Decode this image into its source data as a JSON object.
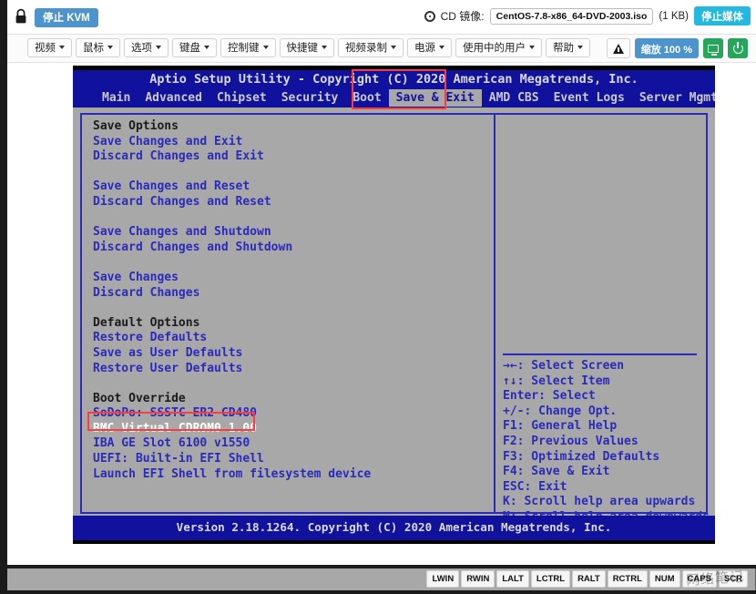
{
  "toolbar": {
    "lock_icon": "lock-icon",
    "stop_kvm_label": "停止 KVM",
    "cd_icon": "cd-disc-icon",
    "cd_label": "CD 镜像:",
    "cd_path": "CentOS-7.8-x86_64-DVD-2003.iso",
    "cd_size": "(1 KB)",
    "stop_media_label": "停止媒体"
  },
  "menubar": {
    "items": [
      {
        "label": "视频"
      },
      {
        "label": "鼠标"
      },
      {
        "label": "选项"
      },
      {
        "label": "键盘"
      },
      {
        "label": "控制键"
      },
      {
        "label": "快捷键"
      },
      {
        "label": "视频录制"
      },
      {
        "label": "电源"
      },
      {
        "label": "使用中的用户"
      },
      {
        "label": "帮助"
      }
    ],
    "warning_icon": "warning-triangle-icon",
    "zoom_label": "缩放 100 %",
    "monitor_icon": "monitor-icon",
    "power_icon": "power-icon"
  },
  "bios": {
    "title": "Aptio Setup Utility - Copyright (C) 2020 American Megatrends, Inc.",
    "tabs": [
      {
        "label": "Main",
        "active": false
      },
      {
        "label": "Advanced",
        "active": false
      },
      {
        "label": "Chipset",
        "active": false
      },
      {
        "label": "Security",
        "active": false
      },
      {
        "label": "Boot",
        "active": false
      },
      {
        "label": "Save & Exit",
        "active": true
      },
      {
        "label": "AMD CBS",
        "active": false
      },
      {
        "label": "Event Logs",
        "active": false
      },
      {
        "label": "Server Mgmt",
        "active": false
      }
    ],
    "left_pane": [
      {
        "text": "Save Options",
        "kind": "hdr"
      },
      {
        "text": "Save Changes and Exit",
        "kind": "opt"
      },
      {
        "text": "Discard Changes and Exit",
        "kind": "opt"
      },
      {
        "text": "",
        "kind": "gap"
      },
      {
        "text": "Save Changes and Reset",
        "kind": "opt"
      },
      {
        "text": "Discard Changes and Reset",
        "kind": "opt"
      },
      {
        "text": "",
        "kind": "gap"
      },
      {
        "text": "Save Changes and Shutdown",
        "kind": "opt"
      },
      {
        "text": "Discard Changes and Shutdown",
        "kind": "opt"
      },
      {
        "text": "",
        "kind": "gap"
      },
      {
        "text": "Save Changes",
        "kind": "opt"
      },
      {
        "text": "Discard Changes",
        "kind": "opt"
      },
      {
        "text": "",
        "kind": "gap"
      },
      {
        "text": "Default Options",
        "kind": "hdr"
      },
      {
        "text": "Restore Defaults",
        "kind": "opt"
      },
      {
        "text": "Save as User Defaults",
        "kind": "opt"
      },
      {
        "text": "Restore User Defaults",
        "kind": "opt"
      },
      {
        "text": "",
        "kind": "gap"
      },
      {
        "text": "Boot Override",
        "kind": "hdr"
      },
      {
        "text": "SoDoPo: SSSTC ER2 CD480",
        "kind": "opt"
      },
      {
        "text": "BMC Virtual CDROM0 1.00",
        "kind": "sel"
      },
      {
        "text": "IBA GE Slot 6100 v1550",
        "kind": "opt"
      },
      {
        "text": "UEFI: Built-in EFI Shell",
        "kind": "opt"
      },
      {
        "text": "Launch EFI Shell from filesystem device",
        "kind": "opt"
      }
    ],
    "help_keys": [
      "→←: Select Screen",
      "↑↓: Select Item",
      "Enter: Select",
      "+/-: Change Opt.",
      "F1: General Help",
      "F2: Previous Values",
      "F3: Optimized Defaults",
      "F4: Save & Exit",
      "ESC: Exit",
      "K: Scroll help area upwards",
      "M: Scroll help area downwards"
    ],
    "footer": "Version 2.18.1264. Copyright (C) 2020 American Megatrends, Inc."
  },
  "statusbar": {
    "keys": [
      "LWIN",
      "RWIN",
      "LALT",
      "LCTRL",
      "RALT",
      "RCTRL",
      "NUM",
      "CAPS",
      "SCR"
    ],
    "watermark": "网络笔记"
  },
  "colors": {
    "accent_blue": "#4d94cc",
    "media_cyan": "#22b8e0",
    "green": "#26a65b",
    "bios_blue": "#10119c",
    "bios_gray": "#a8a8a8",
    "annotation_red": "#ff3b3b"
  }
}
